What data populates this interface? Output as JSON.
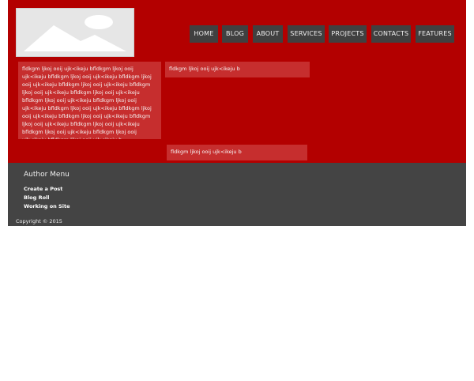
{
  "nav": {
    "items": [
      {
        "label": "HOME"
      },
      {
        "label": "BLOG"
      },
      {
        "label": "ABOUT"
      },
      {
        "label": "SERVICES"
      },
      {
        "label": "PROJECTS"
      },
      {
        "label": "CONTACTS"
      },
      {
        "label": "FEATURES"
      }
    ]
  },
  "content": {
    "left_text": "fldkgm ljkoj ooij ujk<ikeju bfldkgm ljkoj ooij ujk<ikeju bfldkgm ljkoj ooij ujk<ikeju bfldkgm ljkoj ooij ujk<ikeju bfldkgm ljkoj ooij ujk<ikeju bfldkgm ljkoj ooij ujk<ikeju bfldkgm ljkoj ooij ujk<ikeju bfldkgm ljkoj ooij ujk<ikeju bfldkgm ljkoj ooij ujk<ikeju bfldkgm ljkoj ooij ujk<ikeju bfldkgm ljkoj ooij ujk<ikeju bfldkgm ljkoj ooij ujk<ikeju bfldkgm ljkoj ooij ujk<ikeju bfldkgm ljkoj ooij ujk<ikeju bfldkgm ljkoj ooij ujk<ikeju bfldkgm ljkoj ooij ujk<ikeju bfldkgm ljkoj ooij ujk<ikeju b",
    "right_top_text": "fldkgm ljkoj ooij ujk<ikeju b",
    "right_bottom_text": "fldkgm ljkoj ooij ujk<ikeju b"
  },
  "footer": {
    "author_title": "Author Menu",
    "links": [
      {
        "label": "Create a Post"
      },
      {
        "label": "Blog Roll"
      },
      {
        "label": "Working on Site"
      }
    ],
    "copyright": "Copyright © 2015"
  },
  "colors": {
    "header_bg": "#b30000",
    "content_box": "#c62e2e",
    "nav_bg": "#404040",
    "footer_bg": "#444444"
  }
}
